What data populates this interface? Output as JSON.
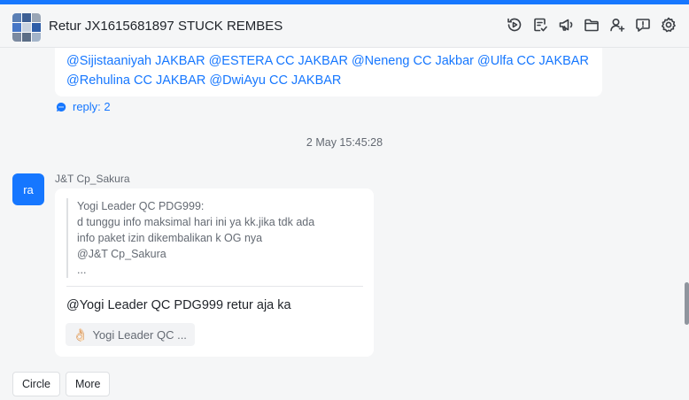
{
  "header": {
    "title": "Retur JX1615681897 STUCK REMBES",
    "group_avatar_colors": [
      "#5a7fb5",
      "#3d5f94",
      "#9aa6b6",
      "#4676c6",
      "#c9d3e0",
      "#2f5ea8",
      "#7b8aa0",
      "#5b6d86",
      "#a3b4c9"
    ],
    "toolbar_icons": [
      "history-icon",
      "tasks-icon",
      "announcement-icon",
      "folder-icon",
      "add-member-icon",
      "feedback-icon",
      "settings-icon"
    ]
  },
  "previous_message": {
    "mentions_line1": "@Sijistaaniyah JAKBAR @ESTERA CC JAKBAR @Neneng CC Jakbar @Ulfa CC JAKBAR",
    "mentions_line2": "@Rehulina CC JAKBAR @DwiAyu CC JAKBAR",
    "reply_label": "reply: 2"
  },
  "timestamp": "2 May 15:45:28",
  "message": {
    "avatar_text": "ra",
    "sender": "J&T Cp_Sakura",
    "quote_lines": [
      "Yogi Leader QC PDG999:",
      "d  tunggu info maksimal hari ini ya kk.jika tdk ada",
      "info paket izin dikembalikan k OG nya",
      "@J&T Cp_Sakura",
      "..."
    ],
    "text": "@Yogi Leader QC PDG999 retur aja ka",
    "reaction_emoji": "👌🏻",
    "reaction_label": "Yogi Leader QC ..."
  },
  "bottom_buttons": {
    "circle": "Circle",
    "more": "More"
  },
  "colors": {
    "accent": "#1677ff",
    "background": "#f5f6f7",
    "card": "#ffffff"
  }
}
